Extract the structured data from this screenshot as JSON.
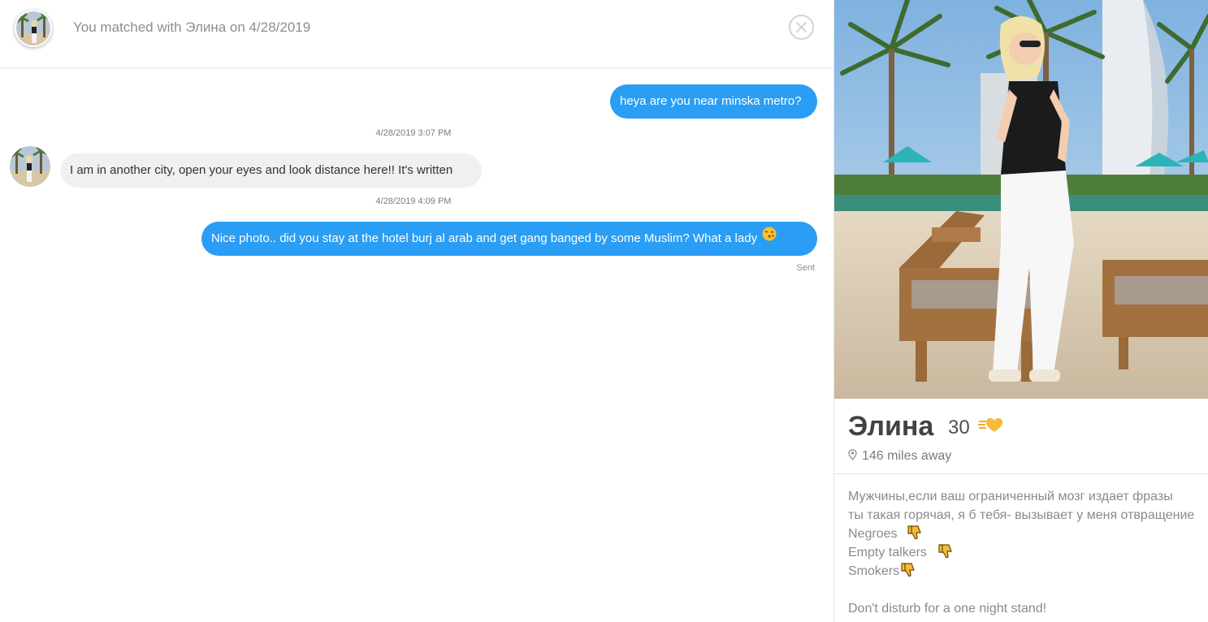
{
  "chat": {
    "match_text": "You matched with Элина on 4/28/2019",
    "messages": [
      {
        "direction": "sent",
        "text": "heya are you near minska metro?"
      },
      {
        "timestamp": "4/28/2019 3:07 PM"
      },
      {
        "direction": "received",
        "text": "I am in another city, open your eyes and look distance here!! It's written"
      },
      {
        "timestamp": "4/28/2019 4:09 PM"
      },
      {
        "direction": "sent",
        "text": "Nice photo.. did you stay at the hotel burj al arab and get gang banged by some Muslim? What a lady",
        "emoji": "winking-kiss-emoji"
      }
    ],
    "sent_status": "Sent"
  },
  "profile": {
    "name": "Элина",
    "age": "30",
    "distance": "146 miles away",
    "bio": {
      "line1": "Мужчины,если ваш ограниченный мозг издает фразы",
      "line2": "ты такая горячая, я б тебя- вызывает у меня отвращение",
      "dislikes": [
        "Negroes",
        "Empty talkers",
        "Smokers"
      ],
      "closing": "Don't disturb for a one night stand!"
    }
  },
  "colors": {
    "sent_bubble": "#2a9df4",
    "received_bubble": "#f0f0f0",
    "muted_text": "#8e8e8e"
  },
  "icons": {
    "close": "close-icon",
    "location": "location-pin-icon",
    "passion": "heart-passions-icon",
    "thumbs_down": "thumbs-down-icon"
  }
}
